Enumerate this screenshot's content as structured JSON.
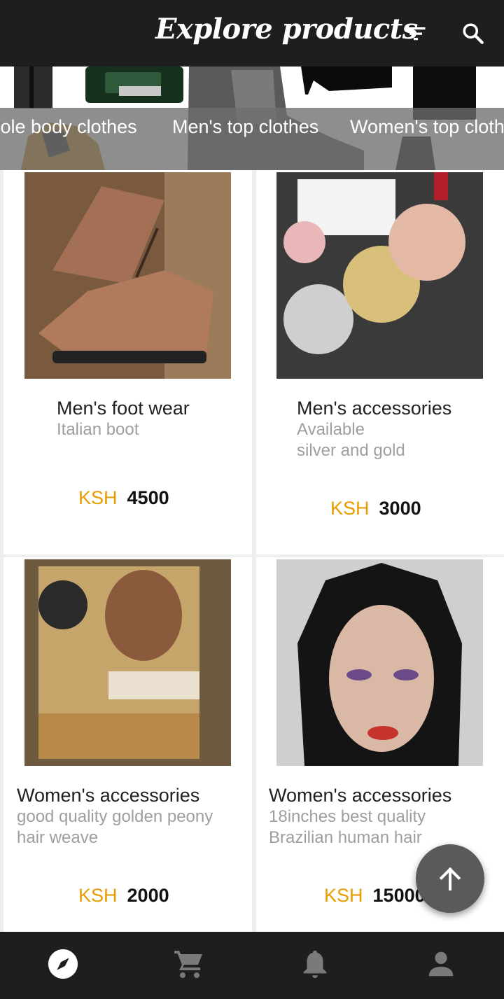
{
  "app": {
    "title": "Explore products"
  },
  "toolbar": {
    "filter_icon": "filter-list-icon",
    "search_icon": "search-icon"
  },
  "categories": [
    {
      "label": "Whole body clothes"
    },
    {
      "label": "Men's top clothes"
    },
    {
      "label": "Women's top clothes"
    }
  ],
  "products": [
    {
      "name": "Men's foot wear",
      "description_lines": [
        "Italian boot"
      ],
      "currency": "KSH",
      "price": "4500"
    },
    {
      "name": "Men's accessories",
      "description_lines": [
        "Available",
        "silver and gold"
      ],
      "currency": "KSH",
      "price": "3000"
    },
    {
      "name": "Women's accessories",
      "description_lines": [
        "good quality golden peony",
        "hair weave"
      ],
      "currency": "KSH",
      "price": "2000"
    },
    {
      "name": "Women's accessories",
      "description_lines": [
        "18inches best quality",
        "Brazilian human hair"
      ],
      "currency": "KSH",
      "price": "15000"
    }
  ],
  "fab": {
    "icon": "arrow-up-icon"
  },
  "bottom_nav": [
    {
      "icon": "compass-icon",
      "active": true
    },
    {
      "icon": "cart-icon",
      "active": false
    },
    {
      "icon": "bell-icon",
      "active": false
    },
    {
      "icon": "person-icon",
      "active": false
    }
  ],
  "colors": {
    "appbar": "#1e1e1e",
    "currency": "#e99c00",
    "description": "#9e9e9e"
  }
}
